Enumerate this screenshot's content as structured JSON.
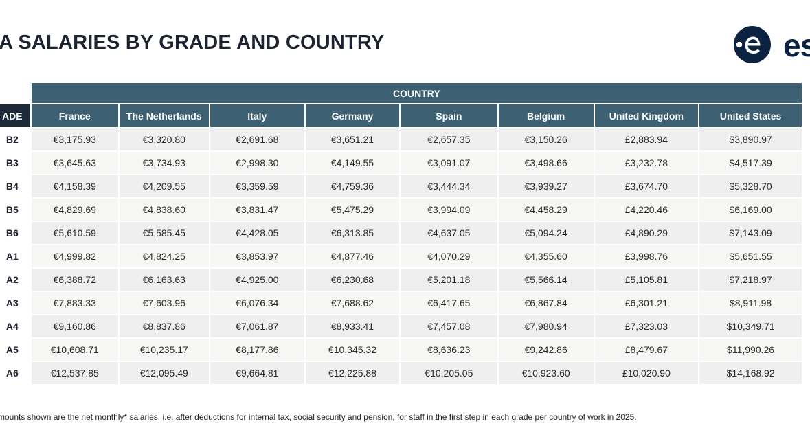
{
  "page": {
    "title": "A SALARIES BY GRADE AND COUNTRY",
    "note": "mounts shown are the net monthly* salaries, i.e. after deductions for internal tax, social security and pension, for staff in the first step in each grade per country of work in 2025."
  },
  "logo": {
    "text": "es",
    "icon": "esa-e-logo-icon",
    "color": "#0b2240"
  },
  "table": {
    "group_header": "COUNTRY",
    "grade_header": "ADE",
    "columns": [
      "France",
      "The Netherlands",
      "Italy",
      "Germany",
      "Spain",
      "Belgium",
      "United Kingdom",
      "United States"
    ],
    "rows": [
      {
        "grade": "B2",
        "values": [
          "€3,175.93",
          "€3,320.80",
          "€2,691.68",
          "€3,651.21",
          "€2,657.35",
          "€3,150.26",
          "£2,883.94",
          "$3,890.97"
        ]
      },
      {
        "grade": "B3",
        "values": [
          "€3,645.63",
          "€3,734.93",
          "€2,998.30",
          "€4,149.55",
          "€3,091.07",
          "€3,498.66",
          "£3,232.78",
          "$4,517.39"
        ]
      },
      {
        "grade": "B4",
        "values": [
          "€4,158.39",
          "€4,209.55",
          "€3,359.59",
          "€4,759.36",
          "€3,444.34",
          "€3,939.27",
          "£3,674.70",
          "$5,328.70"
        ]
      },
      {
        "grade": "B5",
        "values": [
          "€4,829.69",
          "€4,838.60",
          "€3,831.47",
          "€5,475.29",
          "€3,994.09",
          "€4,458.29",
          "£4,220.46",
          "$6,169.00"
        ]
      },
      {
        "grade": "B6",
        "values": [
          "€5,610.59",
          "€5,585.45",
          "€4,428.05",
          "€6,313.85",
          "€4,637.05",
          "€5,094.24",
          "£4,890.29",
          "$7,143.09"
        ]
      },
      {
        "grade": "A1",
        "values": [
          "€4,999.82",
          "€4,824.25",
          "€3,853.97",
          "€4,877.46",
          "€4,070.29",
          "€4,355.60",
          "£3,998.76",
          "$5,651.55"
        ]
      },
      {
        "grade": "A2",
        "values": [
          "€6,388.72",
          "€6,163.63",
          "€4,925.00",
          "€6,230.68",
          "€5,201.18",
          "€5,566.14",
          "£5,105.81",
          "$7,218.97"
        ]
      },
      {
        "grade": "A3",
        "values": [
          "€7,883.33",
          "€7,603.96",
          "€6,076.34",
          "€7,688.62",
          "€6,417.65",
          "€6,867.84",
          "£6,301.21",
          "$8,911.98"
        ]
      },
      {
        "grade": "A4",
        "values": [
          "€9,160.86",
          "€8,837.86",
          "€7,061.87",
          "€8,933.41",
          "€7,457.08",
          "€7,980.94",
          "£7,323.03",
          "$10,349.71"
        ]
      },
      {
        "grade": "A5",
        "values": [
          "€10,608.71",
          "€10,235.17",
          "€8,177.86",
          "€10,345.32",
          "€8,636.23",
          "€9,242.86",
          "£8,479.67",
          "$11,990.26"
        ]
      },
      {
        "grade": "A6",
        "values": [
          "€12,537.85",
          "€12,095.49",
          "€9,664.81",
          "€12,225.88",
          "€10,205.05",
          "€10,923.60",
          "£10,020.90",
          "$14,168.92"
        ]
      }
    ]
  }
}
